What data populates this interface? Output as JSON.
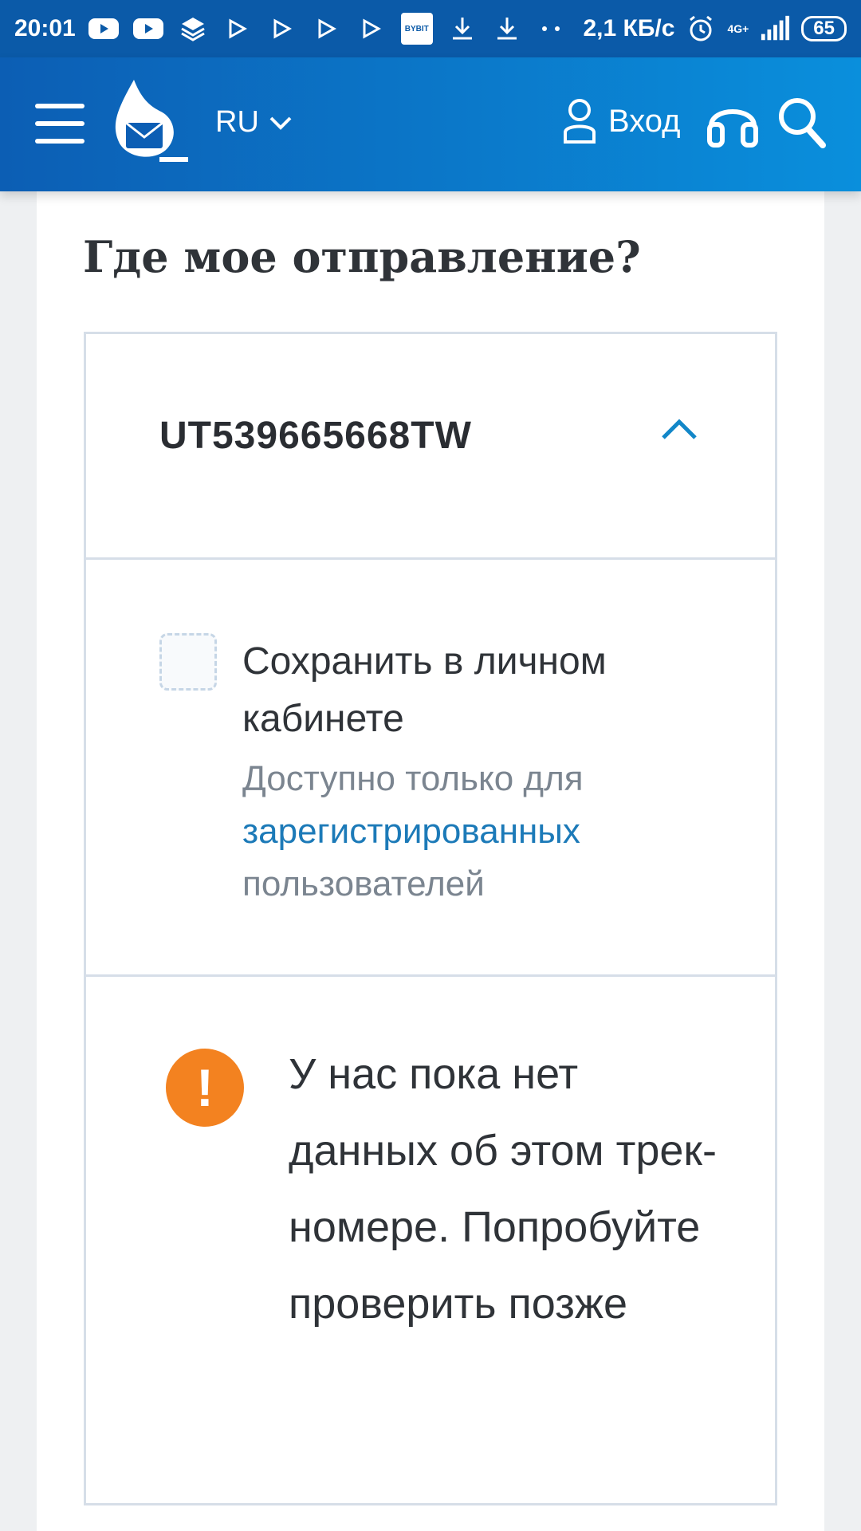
{
  "status_bar": {
    "time": "20:01",
    "network_speed": "2,1 КБ/с",
    "network_type": "4G+",
    "battery": "65",
    "notification_icons": [
      "youtube-icon",
      "youtube-icon",
      "layers-icon",
      "play-icon",
      "play-icon",
      "play-icon",
      "play-icon",
      "bybit-icon",
      "download-icon",
      "download-icon"
    ],
    "bybit_label": "BYBIT"
  },
  "header": {
    "language": "RU",
    "login_label": "Вход",
    "brand_color": "#0c5eb4"
  },
  "page": {
    "title": "Где мое отправление?"
  },
  "tracking": {
    "number": "UT539665668TW",
    "save_label": "Сохранить в личном кабинете",
    "note_prefix": "Доступно только для",
    "note_link": "зарегистрированных",
    "note_suffix": "пользователей",
    "alert_message": "У нас пока нет данных об этом трек-номере. Попробуйте проверить позже",
    "alert_color": "#f38220",
    "link_color": "#1c7ab8"
  }
}
